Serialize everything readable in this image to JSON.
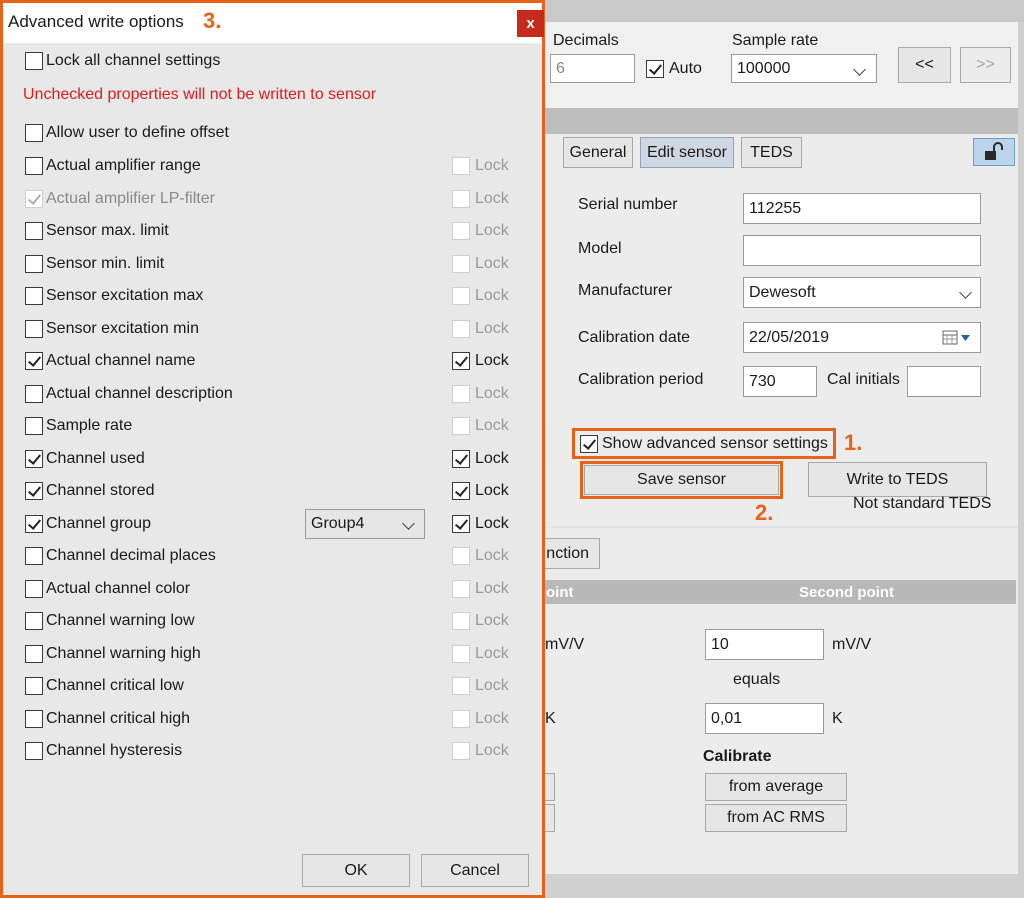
{
  "dialog": {
    "title": "Advanced write options",
    "step_marker": "3.",
    "close_glyph": "x",
    "lock_all_label": "Lock all channel settings",
    "warning": "Unchecked properties will not be written to sensor",
    "allow_offset_label": "Allow user to define offset",
    "lock_label": "Lock",
    "group_value": "Group4",
    "rows": [
      {
        "label": "Actual amplifier range",
        "checked": false,
        "lock": false
      },
      {
        "label": "Actual amplifier LP-filter",
        "checked": true,
        "lock": false
      },
      {
        "label": "Sensor max. limit",
        "checked": false,
        "lock": false
      },
      {
        "label": "Sensor min. limit",
        "checked": false,
        "lock": false
      },
      {
        "label": "Sensor excitation max",
        "checked": false,
        "lock": false
      },
      {
        "label": "Sensor excitation min",
        "checked": false,
        "lock": false
      },
      {
        "label": "Actual channel name",
        "checked": true,
        "lock": true
      },
      {
        "label": "Actual channel description",
        "checked": false,
        "lock": false
      },
      {
        "label": "Sample rate",
        "checked": false,
        "lock": false
      },
      {
        "label": "Channel used",
        "checked": true,
        "lock": true
      },
      {
        "label": "Channel stored",
        "checked": true,
        "lock": true
      },
      {
        "label": "Channel group",
        "checked": true,
        "lock": true
      },
      {
        "label": "Channel decimal places",
        "checked": false,
        "lock": false
      },
      {
        "label": "Actual channel color",
        "checked": false,
        "lock": false
      },
      {
        "label": "Channel warning low",
        "checked": false,
        "lock": false
      },
      {
        "label": "Channel warning high",
        "checked": false,
        "lock": false
      },
      {
        "label": "Channel critical low",
        "checked": false,
        "lock": false
      },
      {
        "label": "Channel critical high",
        "checked": false,
        "lock": false
      },
      {
        "label": "Channel hysteresis",
        "checked": false,
        "lock": false
      }
    ],
    "ok_label": "OK",
    "cancel_label": "Cancel"
  },
  "toolbar": {
    "decimals_label": "Decimals",
    "decimals_value": "6",
    "auto_label": "Auto",
    "sample_rate_label": "Sample rate",
    "sample_rate_value": "100000",
    "prev_label": "<<",
    "next_label": ">>"
  },
  "tabs": [
    "General",
    "Edit sensor",
    "TEDS"
  ],
  "sensor": {
    "serial_number_label": "Serial number",
    "serial_number_value": "112255",
    "model_label": "Model",
    "model_value": "",
    "manufacturer_label": "Manufacturer",
    "manufacturer_value": "Dewesoft",
    "calibration_date_label": "Calibration date",
    "calibration_date_value": "22/05/2019",
    "calibration_period_label": "Calibration period",
    "calibration_period_value": "730",
    "cal_initials_label": "Cal initials",
    "cal_initials_value": "",
    "show_advanced_label": "Show advanced sensor settings",
    "step1": "1.",
    "save_label": "Save sensor",
    "step2": "2.",
    "write_teds_label": "Write to TEDS",
    "teds_status": "Not standard TEDS"
  },
  "calibration": {
    "function_tab_fragment": "nction",
    "first_point_fragment": "oint",
    "second_point_label": "Second point",
    "first_unit_fragment": "mV/V",
    "second_value": "10",
    "second_unit": "mV/V",
    "equals_label": "equals",
    "first_k_fragment": "K",
    "second_k_value": "0,01",
    "second_k_unit": "K",
    "calibrate_label": "Calibrate",
    "from_average_label": "from average",
    "from_ac_rms_label": "from AC RMS"
  },
  "colors": {
    "accent": "#e8631a",
    "warning": "#e21b1b",
    "close_button": "#c42b1c"
  }
}
